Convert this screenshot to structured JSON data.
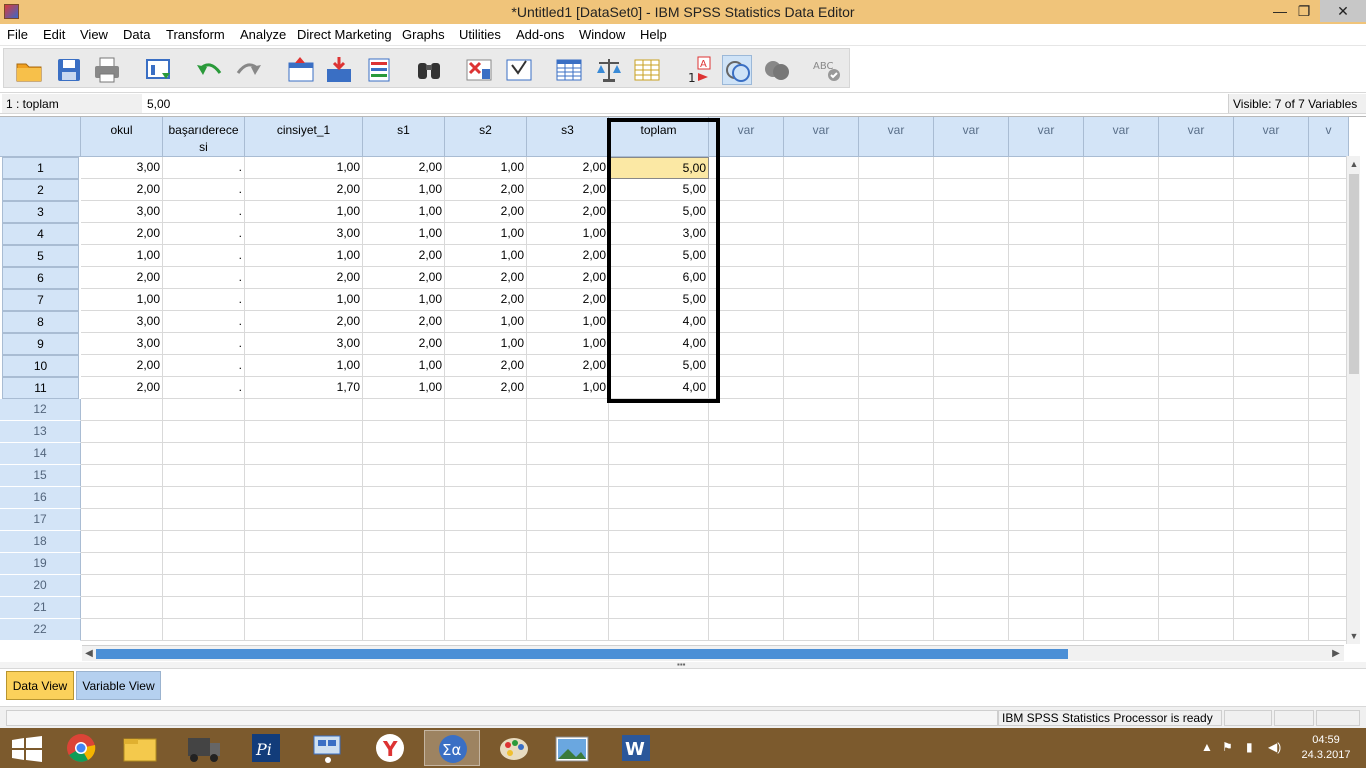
{
  "window": {
    "title": "*Untitled1 [DataSet0] - IBM SPSS Statistics Data Editor",
    "minimize": "—",
    "maximize": "❐",
    "close": "✕"
  },
  "menu": [
    "File",
    "Edit",
    "View",
    "Data",
    "Transform",
    "Analyze",
    "Direct Marketing",
    "Graphs",
    "Utilities",
    "Add-ons",
    "Window",
    "Help"
  ],
  "toolbar": {
    "icons": [
      "open-icon",
      "save-icon",
      "print-icon",
      "dialog-recall-icon",
      "undo-icon",
      "redo-icon",
      "goto-case-icon",
      "goto-variable-icon",
      "variables-icon",
      "find-icon",
      "insert-cases-icon",
      "insert-variable-icon",
      "split-file-icon",
      "weight-cases-icon",
      "select-cases-icon",
      "value-labels-icon",
      "use-sets-icon",
      "show-all-variables-icon",
      "spell-check-icon"
    ]
  },
  "cellbar": {
    "ref": "1 : toplam",
    "value": "5,00",
    "visible": "Visible: 7 of 7 Variables"
  },
  "columns": [
    "okul",
    "başarıderece si",
    "cinsiyet_1",
    "s1",
    "s2",
    "s3",
    "toplam"
  ],
  "empty_columns": [
    "var",
    "var",
    "var",
    "var",
    "var",
    "var",
    "var",
    "var",
    "v"
  ],
  "rows": [
    [
      "3,00",
      ".",
      "1,00",
      "2,00",
      "1,00",
      "2,00",
      "5,00"
    ],
    [
      "2,00",
      ".",
      "2,00",
      "1,00",
      "2,00",
      "2,00",
      "5,00"
    ],
    [
      "3,00",
      ".",
      "1,00",
      "1,00",
      "2,00",
      "2,00",
      "5,00"
    ],
    [
      "2,00",
      ".",
      "3,00",
      "1,00",
      "1,00",
      "1,00",
      "3,00"
    ],
    [
      "1,00",
      ".",
      "1,00",
      "2,00",
      "1,00",
      "2,00",
      "5,00"
    ],
    [
      "2,00",
      ".",
      "2,00",
      "2,00",
      "2,00",
      "2,00",
      "6,00"
    ],
    [
      "1,00",
      ".",
      "1,00",
      "1,00",
      "2,00",
      "2,00",
      "5,00"
    ],
    [
      "3,00",
      ".",
      "2,00",
      "2,00",
      "1,00",
      "1,00",
      "4,00"
    ],
    [
      "3,00",
      ".",
      "3,00",
      "2,00",
      "1,00",
      "1,00",
      "4,00"
    ],
    [
      "2,00",
      ".",
      "1,00",
      "1,00",
      "2,00",
      "2,00",
      "5,00"
    ],
    [
      "2,00",
      ".",
      "1,70",
      "1,00",
      "2,00",
      "1,00",
      "4,00"
    ]
  ],
  "row_numbers": [
    "1",
    "2",
    "3",
    "4",
    "5",
    "6",
    "7",
    "8",
    "9",
    "10",
    "11",
    "12",
    "13",
    "14",
    "15",
    "16",
    "17",
    "18",
    "19",
    "20",
    "21",
    "22"
  ],
  "tabs": {
    "data_view": "Data View",
    "variable_view": "Variable View"
  },
  "status": {
    "message": "IBM SPSS Statistics Processor is ready"
  },
  "taskbar": {
    "apps": [
      "windows-start-icon",
      "chrome-icon",
      "file-explorer-icon",
      "truck-app-icon",
      "pascal-app-icon",
      "network-app-icon",
      "yandex-icon",
      "spss-icon",
      "paint-icon",
      "photos-icon",
      "word-icon"
    ],
    "time": "04:59",
    "date": "24.3.2017"
  }
}
